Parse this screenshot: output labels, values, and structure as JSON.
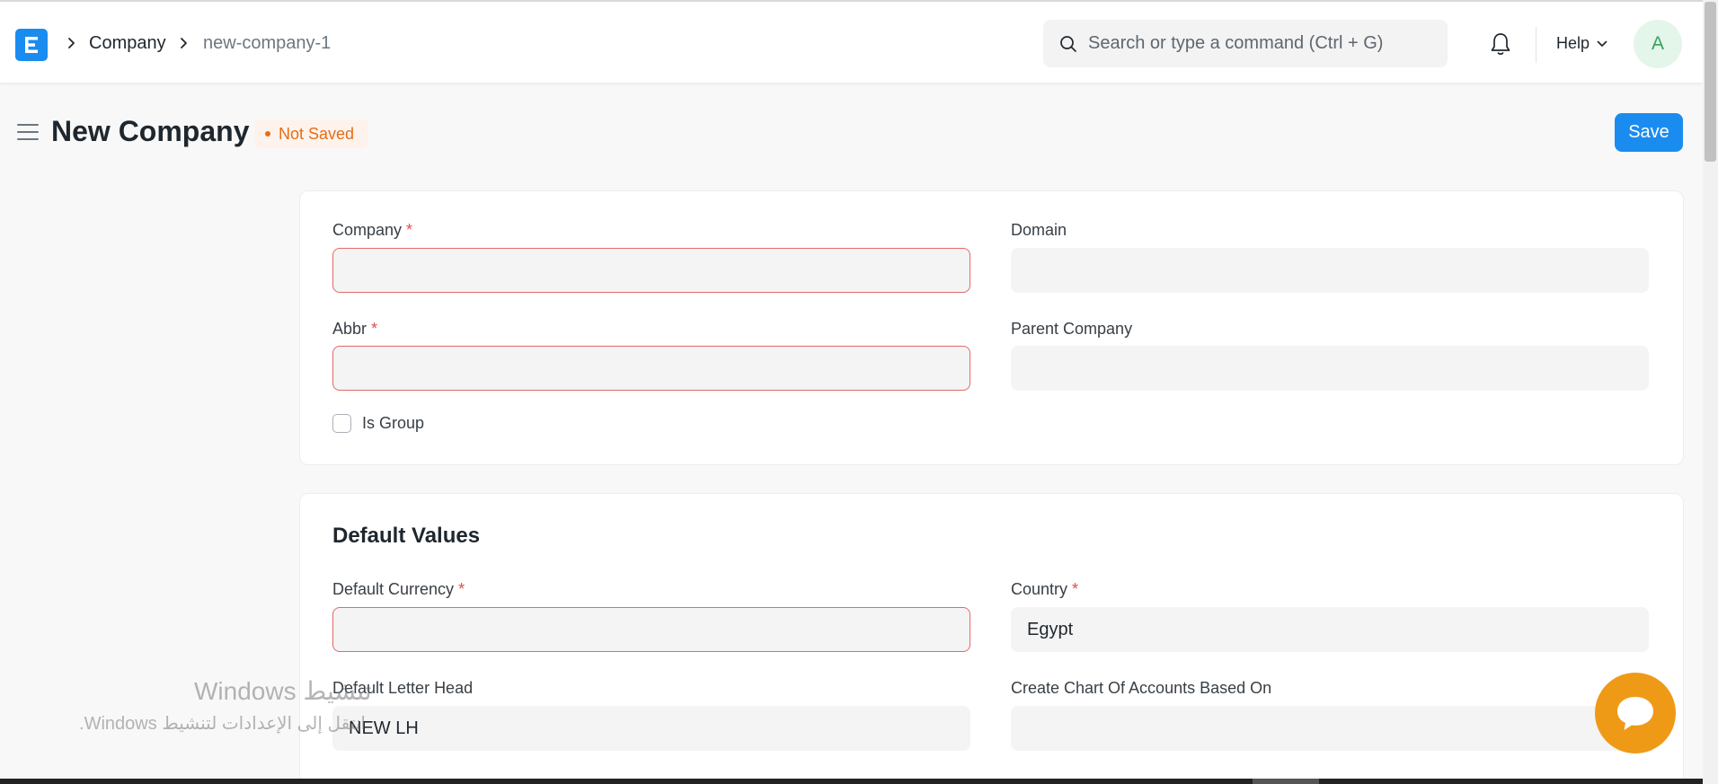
{
  "navbar": {
    "logo_letter": "E",
    "breadcrumbs": [
      "Company",
      "new-company-1"
    ],
    "search": {
      "placeholder": "Search or type a command (Ctrl + G)"
    },
    "help_label": "Help",
    "avatar_initial": "A"
  },
  "page": {
    "title": "New Company",
    "status": "Not Saved",
    "save_label": "Save"
  },
  "section_main": {
    "company_label": "Company",
    "company_value": "",
    "domain_label": "Domain",
    "domain_value": "",
    "abbr_label": "Abbr",
    "abbr_value": "",
    "parent_company_label": "Parent Company",
    "parent_company_value": "",
    "is_group_label": "Is Group",
    "required_mark": "*"
  },
  "section_defaults": {
    "title": "Default Values",
    "default_currency_label": "Default Currency",
    "default_currency_value": "",
    "country_label": "Country",
    "country_value": "Egypt",
    "default_letter_head_label": "Default Letter Head",
    "default_letter_head_value": "NEW LH",
    "chart_of_accounts_label": "Create Chart Of Accounts Based On",
    "chart_of_accounts_value": ""
  },
  "watermark": {
    "line1": "Windows تنشيط",
    "line2": "انتقل إلى الإعدادات لتنشيط Windows."
  },
  "colors": {
    "primary": "#1a8cf0",
    "status_orange": "#e86c13",
    "required_red": "#e24c4c",
    "chat_orange": "#ef9a17"
  },
  "icons": [
    "app-logo",
    "chevron-right-icon",
    "search-icon",
    "bell-icon",
    "chevron-down-icon",
    "menu-icon",
    "chat-icon"
  ]
}
